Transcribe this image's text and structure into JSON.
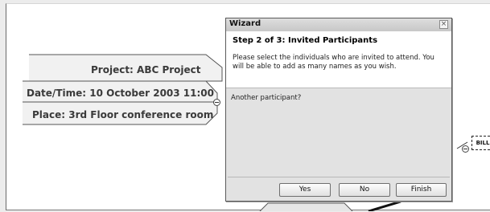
{
  "mindmap": {
    "node_project": "Project: ABC Project",
    "node_datetime": "Date/Time: 10 October 2003 11:00",
    "node_place": "Place: 3rd Floor conference room",
    "person_icon_text": "BILL"
  },
  "wizard": {
    "title": "Wizard",
    "close_glyph": "×",
    "step_title": "Step 2 of 3: Invited Participants",
    "description": "Please select the individuals who are invited to attend. You will be able to add as many names as you wish.",
    "question": "Another participant?",
    "buttons": {
      "yes": "Yes",
      "no": "No",
      "finish": "Finish"
    }
  }
}
